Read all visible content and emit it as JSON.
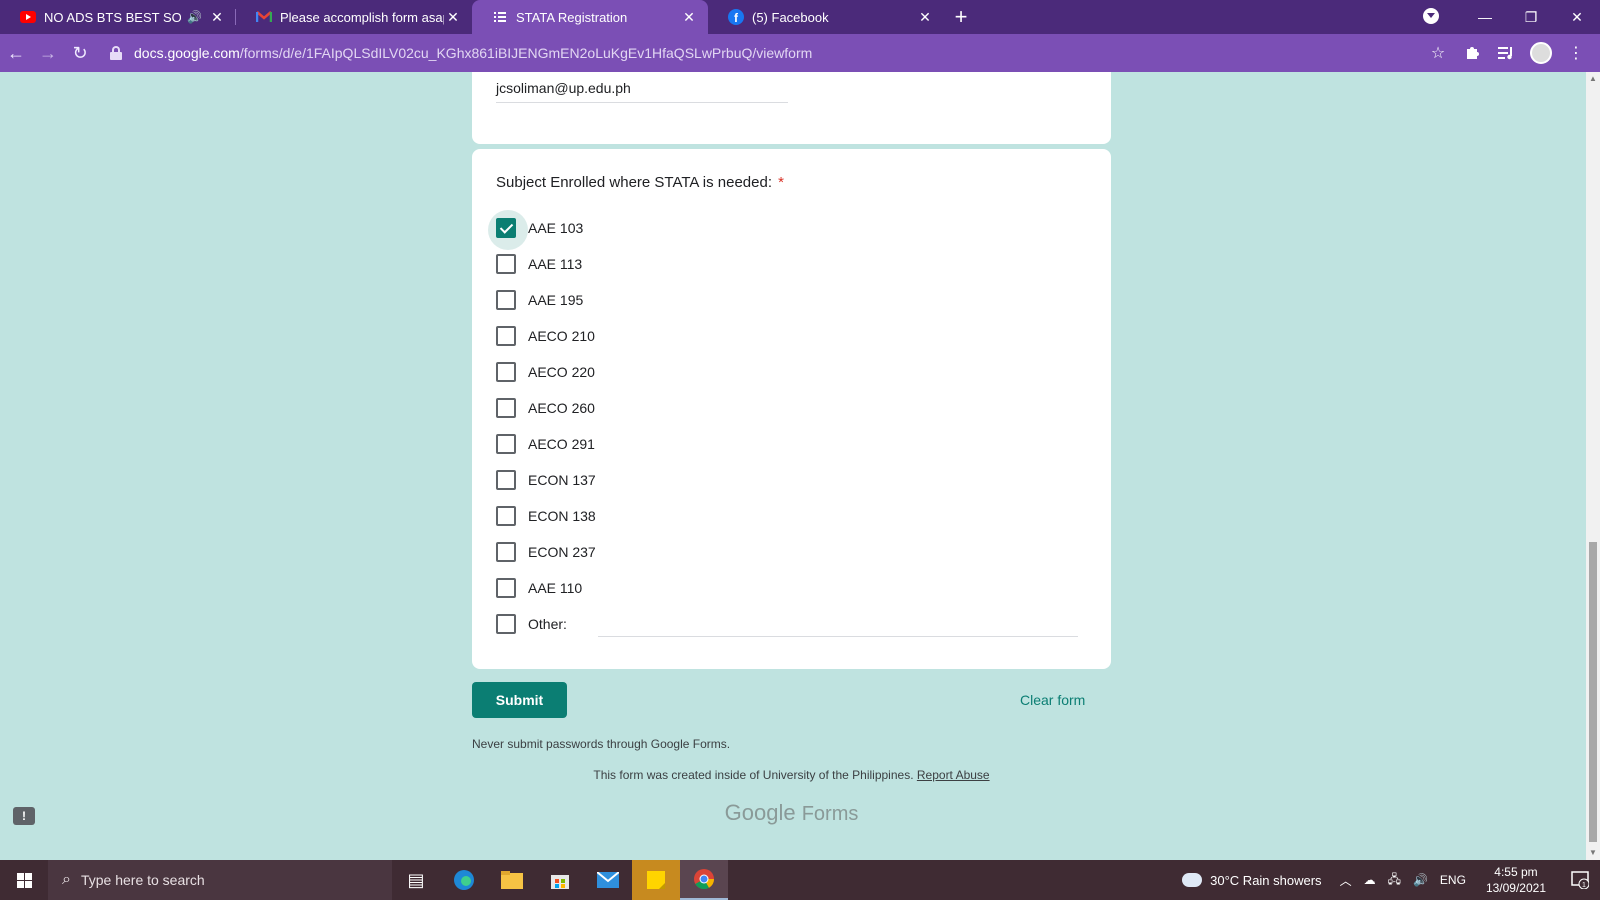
{
  "browser": {
    "tabs": [
      {
        "title": "NO ADS BTS BEST SONGS PL",
        "icon": "youtube-icon",
        "audio": true,
        "active": false
      },
      {
        "title": "Please accomplish form asap RE:",
        "icon": "gmail-icon",
        "active": false
      },
      {
        "title": "STATA Registration",
        "icon": "google-forms-icon",
        "active": true
      },
      {
        "title": "(5) Facebook",
        "icon": "facebook-icon",
        "active": false
      }
    ],
    "url_host": "docs.google.com",
    "url_path": "/forms/d/e/1FAIpQLSdILV02cu_KGhx861iBIJENGmEN2oLuKgEv1HfaQSLwPrbuQ/viewform"
  },
  "form": {
    "email_value": "jcsoliman@up.edu.ph",
    "question_title": "Subject Enrolled where STATA is needed:",
    "required_mark": "*",
    "options": [
      {
        "label": "AAE 103",
        "checked": true
      },
      {
        "label": "AAE 113",
        "checked": false
      },
      {
        "label": "AAE 195",
        "checked": false
      },
      {
        "label": "AECO 210",
        "checked": false
      },
      {
        "label": "AECO 220",
        "checked": false
      },
      {
        "label": "AECO 260",
        "checked": false
      },
      {
        "label": "AECO 291",
        "checked": false
      },
      {
        "label": "ECON 137",
        "checked": false
      },
      {
        "label": "ECON 138",
        "checked": false
      },
      {
        "label": "ECON 237",
        "checked": false
      },
      {
        "label": "AAE 110",
        "checked": false
      },
      {
        "label": "Other:",
        "checked": false
      }
    ],
    "submit_label": "Submit",
    "clear_label": "Clear form",
    "never_submit": "Never submit passwords through Google Forms.",
    "created_text": "This form was created inside of University of the Philippines.",
    "report_abuse": "Report Abuse",
    "brand_google": "Google",
    "brand_forms": "Forms"
  },
  "taskbar": {
    "search_placeholder": "Type here to search",
    "weather": "30°C  Rain showers",
    "language": "ENG",
    "time": "4:55 pm",
    "date": "13/09/2021",
    "notification_count": "1"
  },
  "colors": {
    "accent": "#0b7e73",
    "page_bg": "#bfe3e0",
    "tabstrip": "#4b2a7a",
    "toolbar": "#7b4fb5"
  }
}
